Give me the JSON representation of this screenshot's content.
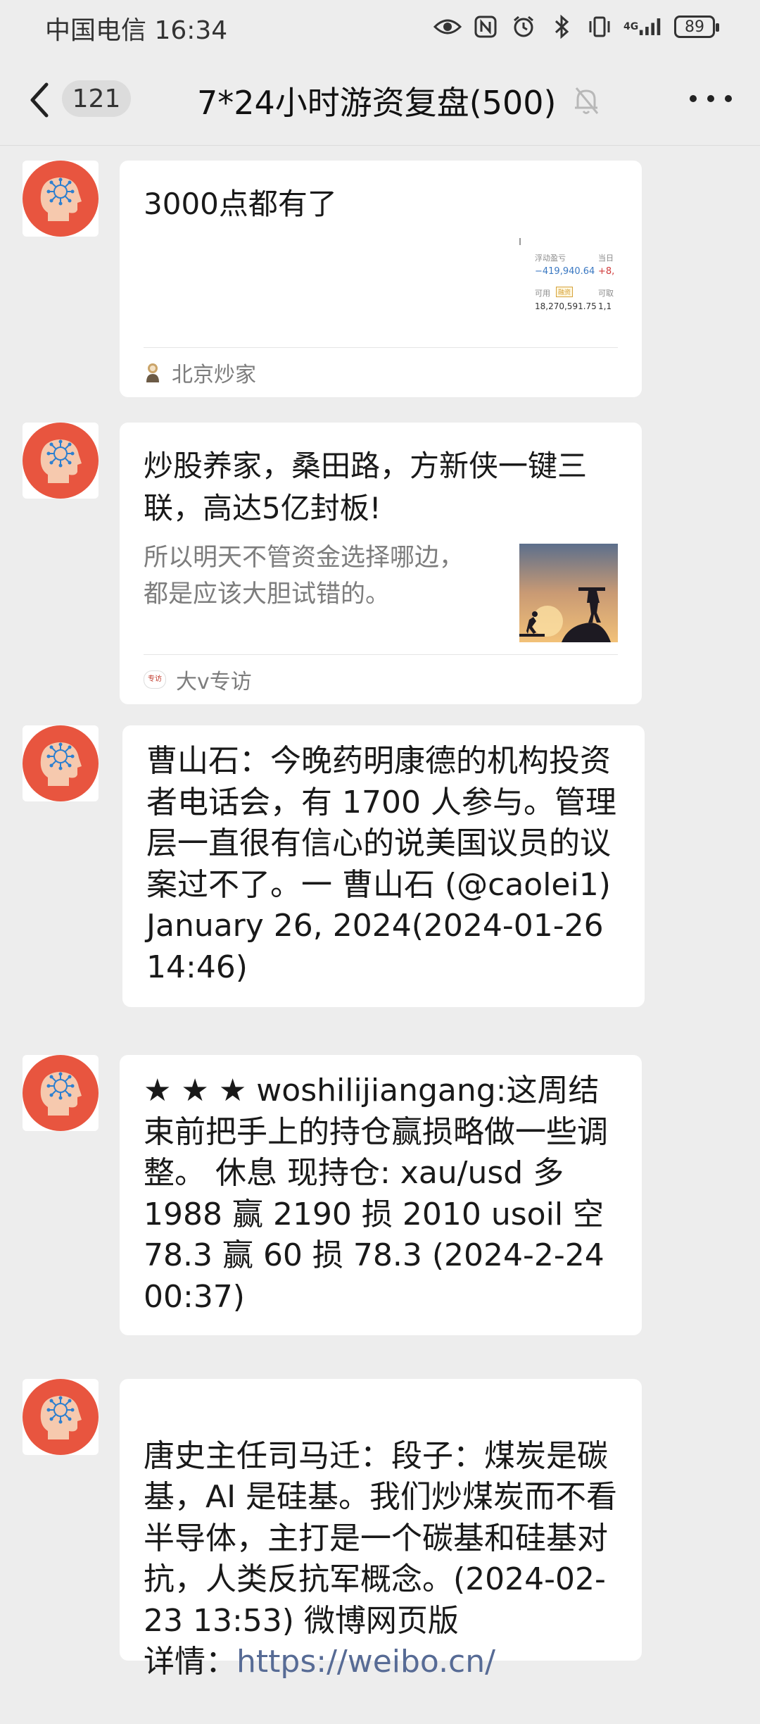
{
  "status_bar": {
    "carrier_time": "中国电信 16:34",
    "network_label": "4G",
    "battery": "89",
    "icons": [
      "eye-icon",
      "nfc-icon",
      "alarm-icon",
      "bluetooth-icon",
      "vibrate-icon",
      "signal-icon",
      "battery-icon"
    ]
  },
  "nav": {
    "unread_count": "121",
    "title": "7*24小时游资复盘(500)",
    "icons": [
      "back-chevron-icon",
      "mute-bell-icon",
      "more-icon"
    ]
  },
  "messages": [
    {
      "type": "link_card",
      "title": "3000点都有了",
      "thumbnail": {
        "label1": "浮动盈亏",
        "value1": "−419,940.64",
        "label2": "当日",
        "value2": "+8,",
        "label3": "可用",
        "tag": "融资",
        "value3": "18,270,591.75",
        "label4": "可取",
        "value4": "1,1"
      },
      "source": "北京炒家"
    },
    {
      "type": "link_card",
      "title": "炒股养家，桑田路，方新侠一键三联，高达5亿封板!",
      "description": "所以明天不管资金选择哪边，都是应该大胆试错的。",
      "source": "大v专访",
      "source_icon_text": "专访"
    },
    {
      "type": "text",
      "text": "曹山石：今晚药明康德的机构投资者电话会，有 1700 人参与。管理层一直很有信心的说美国议员的议案过不了。一 曹山石 (@caolei1) January 26, 2024(2024-01-26 14:46)"
    },
    {
      "type": "text",
      "text": "★ ★ ★ woshilijiangang:这周结束前把手上的持仓赢损略做一些调整。 休息 现持仓: xau/usd 多 1988 赢 2190 损 2010 usoil 空 78.3 赢 60 损 78.3 (2024-2-24 00:37)"
    },
    {
      "type": "text",
      "text": "唐史主任司马迁：段子：煤炭是碳基，AI 是硅基。我们炒煤炭而不看半导体，主打是一个碳基和硅基对抗，人类反抗军概念。(2024-02-23 13:53) 微博网页版",
      "link_prefix": "详情：",
      "link": "https://weibo.cn/"
    }
  ],
  "colors": {
    "background": "#ededed",
    "bubble": "#ffffff",
    "avatar_red": "#e8553f",
    "link": "#576b95"
  }
}
